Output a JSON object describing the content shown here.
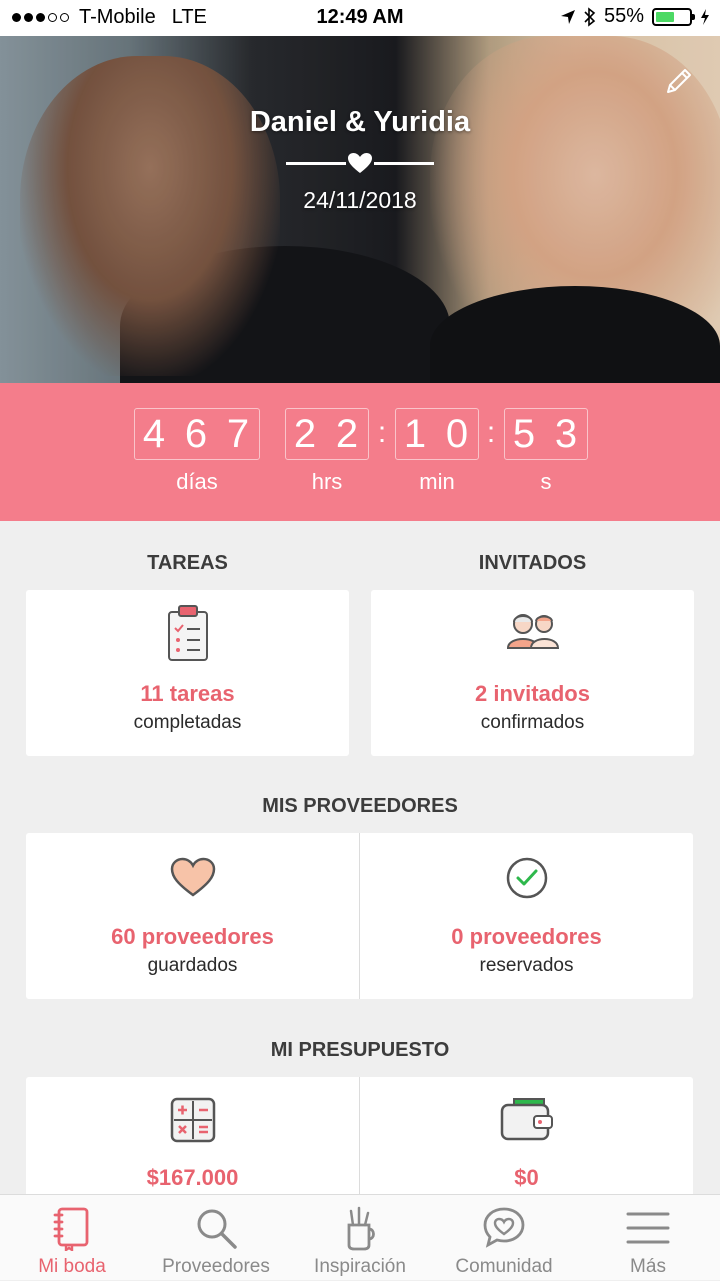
{
  "status_bar": {
    "carrier": "T-Mobile",
    "network": "LTE",
    "time": "12:49 AM",
    "battery_percent": "55%",
    "battery_level": 0.55
  },
  "hero": {
    "couple_names": "Daniel & Yuridia",
    "wedding_date": "24/11/2018"
  },
  "countdown": {
    "days_digits": [
      "4",
      "6",
      "7"
    ],
    "hours_digits": [
      "2",
      "2"
    ],
    "minutes_digits": [
      "1",
      "0"
    ],
    "seconds_digits": [
      "5",
      "3"
    ],
    "separator": ":",
    "labels": {
      "days": "días",
      "hours": "hrs",
      "minutes": "min",
      "seconds": "s"
    }
  },
  "tareas": {
    "title": "TAREAS",
    "count": "11 tareas",
    "status": "completadas"
  },
  "invitados": {
    "title": "INVITADOS",
    "count": "2 invitados",
    "status": "confirmados"
  },
  "proveedores": {
    "title": "MIS PROVEEDORES",
    "saved_count": "60 proveedores",
    "saved_label": "guardados",
    "booked_count": "0 proveedores",
    "booked_label": "reservados"
  },
  "presupuesto": {
    "title": "MI PRESUPUESTO",
    "estimated": "$167.000",
    "spent": "$0"
  },
  "tabbar": {
    "items": [
      {
        "label": "Mi boda",
        "icon": "notebook-icon",
        "active": true
      },
      {
        "label": "Proveedores",
        "icon": "search-icon",
        "active": false
      },
      {
        "label": "Inspiración",
        "icon": "inspiration-cup-icon",
        "active": false
      },
      {
        "label": "Comunidad",
        "icon": "chat-heart-icon",
        "active": false
      },
      {
        "label": "Más",
        "icon": "menu-icon",
        "active": false
      }
    ]
  },
  "colors": {
    "accent": "#e8636f",
    "countdown_bg": "#f47d8b",
    "page_bg": "#efefef",
    "battery": "#4cd964"
  }
}
